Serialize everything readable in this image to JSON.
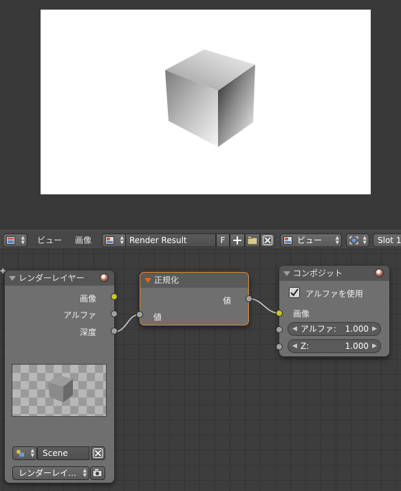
{
  "header": {
    "menu_view": "ビュー",
    "menu_image": "画像",
    "image_name": "Render Result",
    "fake_user": "F",
    "view_select": "ビュー",
    "slot_label": "Slot 1"
  },
  "nodes": {
    "render_layers": {
      "title": "レンダーレイヤー",
      "outputs": [
        "画像",
        "アルファ",
        "深度"
      ],
      "scene_name": "Scene",
      "layer_name": "レンダーレイ…"
    },
    "normalize": {
      "title": "正規化",
      "output": "値",
      "input": "値"
    },
    "composite": {
      "title": "コンポジット",
      "use_alpha_label": "アルファを使用",
      "use_alpha_checked": true,
      "input_image": "画像",
      "alpha_label": "アルファ:",
      "alpha_value": "1.000",
      "z_label": "Z:",
      "z_value": "1.000"
    }
  },
  "colors": {
    "socket_image": "#c7c729",
    "socket_value": "#a1a1a1",
    "selected_outline": "#e6892a",
    "node_body": "#6f6f6f",
    "node_header": "#555555"
  }
}
